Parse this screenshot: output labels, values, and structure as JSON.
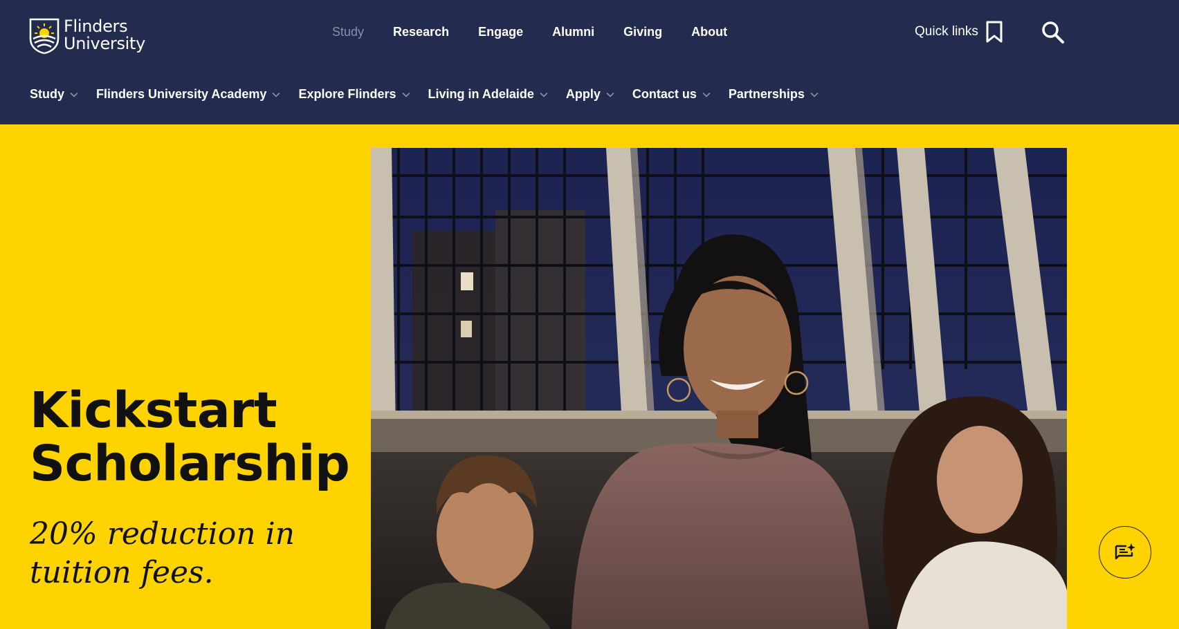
{
  "brand": {
    "line1": "Flinders",
    "line2": "University"
  },
  "top_nav": [
    {
      "label": "Study",
      "state": "muted"
    },
    {
      "label": "Research"
    },
    {
      "label": "Engage"
    },
    {
      "label": "Alumni"
    },
    {
      "label": "Giving"
    },
    {
      "label": "About"
    }
  ],
  "quick_links": {
    "label": "Quick links",
    "icon": "bookmark-icon"
  },
  "search": {
    "icon": "search-icon"
  },
  "sub_nav": [
    {
      "label": "Study"
    },
    {
      "label": "Flinders University Academy"
    },
    {
      "label": "Explore Flinders"
    },
    {
      "label": "Living in Adelaide"
    },
    {
      "label": "Apply"
    },
    {
      "label": "Contact us"
    },
    {
      "label": "Partnerships"
    }
  ],
  "hero": {
    "title_line1": "Kickstart",
    "title_line2": "Scholarship",
    "subtitle_line1": "20% reduction in",
    "subtitle_line2": "tuition fees."
  },
  "feedback": {
    "icon": "feedback-sparkle-icon"
  },
  "colors": {
    "navy": "#232c4e",
    "yellow": "#ffd300",
    "muted_nav": "#8b90a4"
  }
}
